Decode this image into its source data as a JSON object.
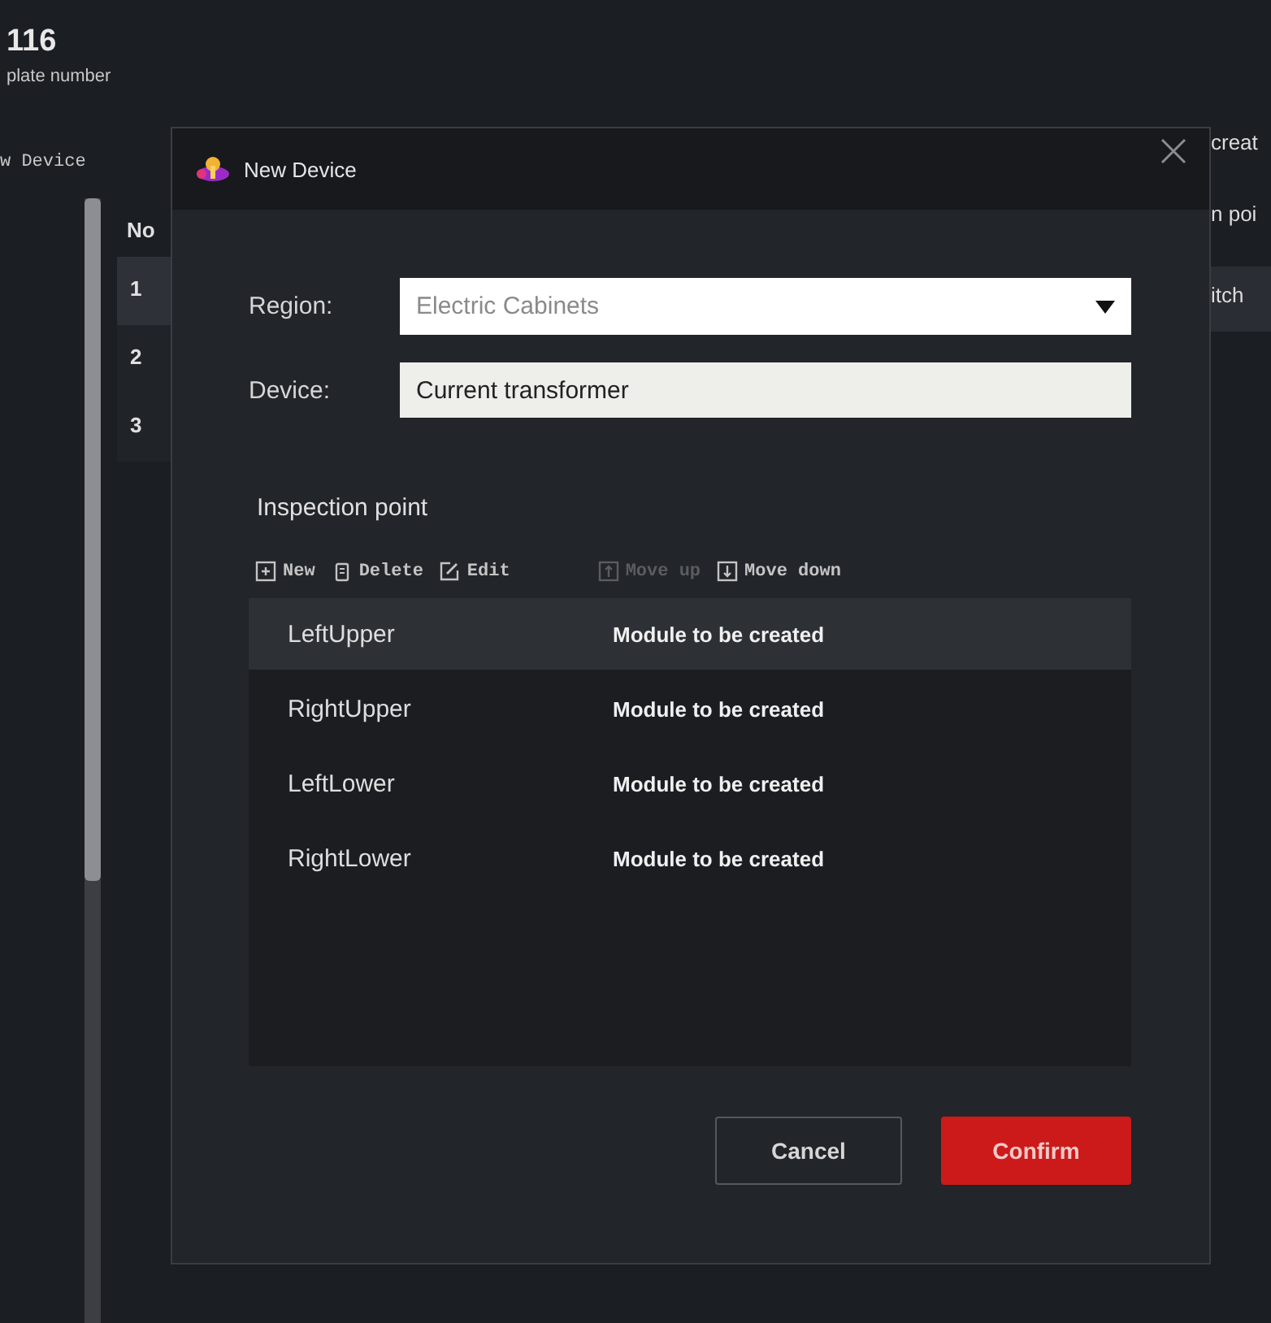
{
  "background": {
    "header": {
      "value": "116",
      "label": "plate number"
    },
    "toolbar_label": "w Device",
    "table": {
      "column": "No",
      "rows": [
        {
          "no": "1",
          "selected": true
        },
        {
          "no": "2",
          "selected": false
        },
        {
          "no": "3",
          "selected": false
        }
      ]
    },
    "right_texts": [
      {
        "text": "creat",
        "selected": false
      },
      {
        "text": "n poi",
        "selected": false
      },
      {
        "text": "itch",
        "selected": true
      }
    ]
  },
  "dialog": {
    "title": "New Device",
    "fields": [
      {
        "kind": "dropdown",
        "label": "Region:",
        "value": "Electric Cabinets"
      },
      {
        "kind": "text",
        "label": "Device:",
        "value": "Current transformer"
      }
    ],
    "section_title": "Inspection point",
    "toolbar": [
      {
        "kind": "new",
        "label": "New",
        "disabled": false
      },
      {
        "kind": "delete",
        "label": "Delete",
        "disabled": false
      },
      {
        "kind": "edit",
        "label": "Edit",
        "disabled": false
      },
      {
        "kind": "move_up",
        "label": "Move up",
        "disabled": true
      },
      {
        "kind": "move_down",
        "label": "Move down",
        "disabled": false
      }
    ],
    "points": [
      {
        "name": "LeftUpper",
        "status": "Module to be created",
        "selected": true
      },
      {
        "name": "RightUpper",
        "status": "Module to be created",
        "selected": false
      },
      {
        "name": "LeftLower",
        "status": "Module to be created",
        "selected": false
      },
      {
        "name": "RightLower",
        "status": "Module to be created",
        "selected": false
      }
    ],
    "buttons": [
      {
        "kind": "secondary",
        "label": "Cancel"
      },
      {
        "kind": "primary",
        "label": "Confirm"
      }
    ]
  }
}
